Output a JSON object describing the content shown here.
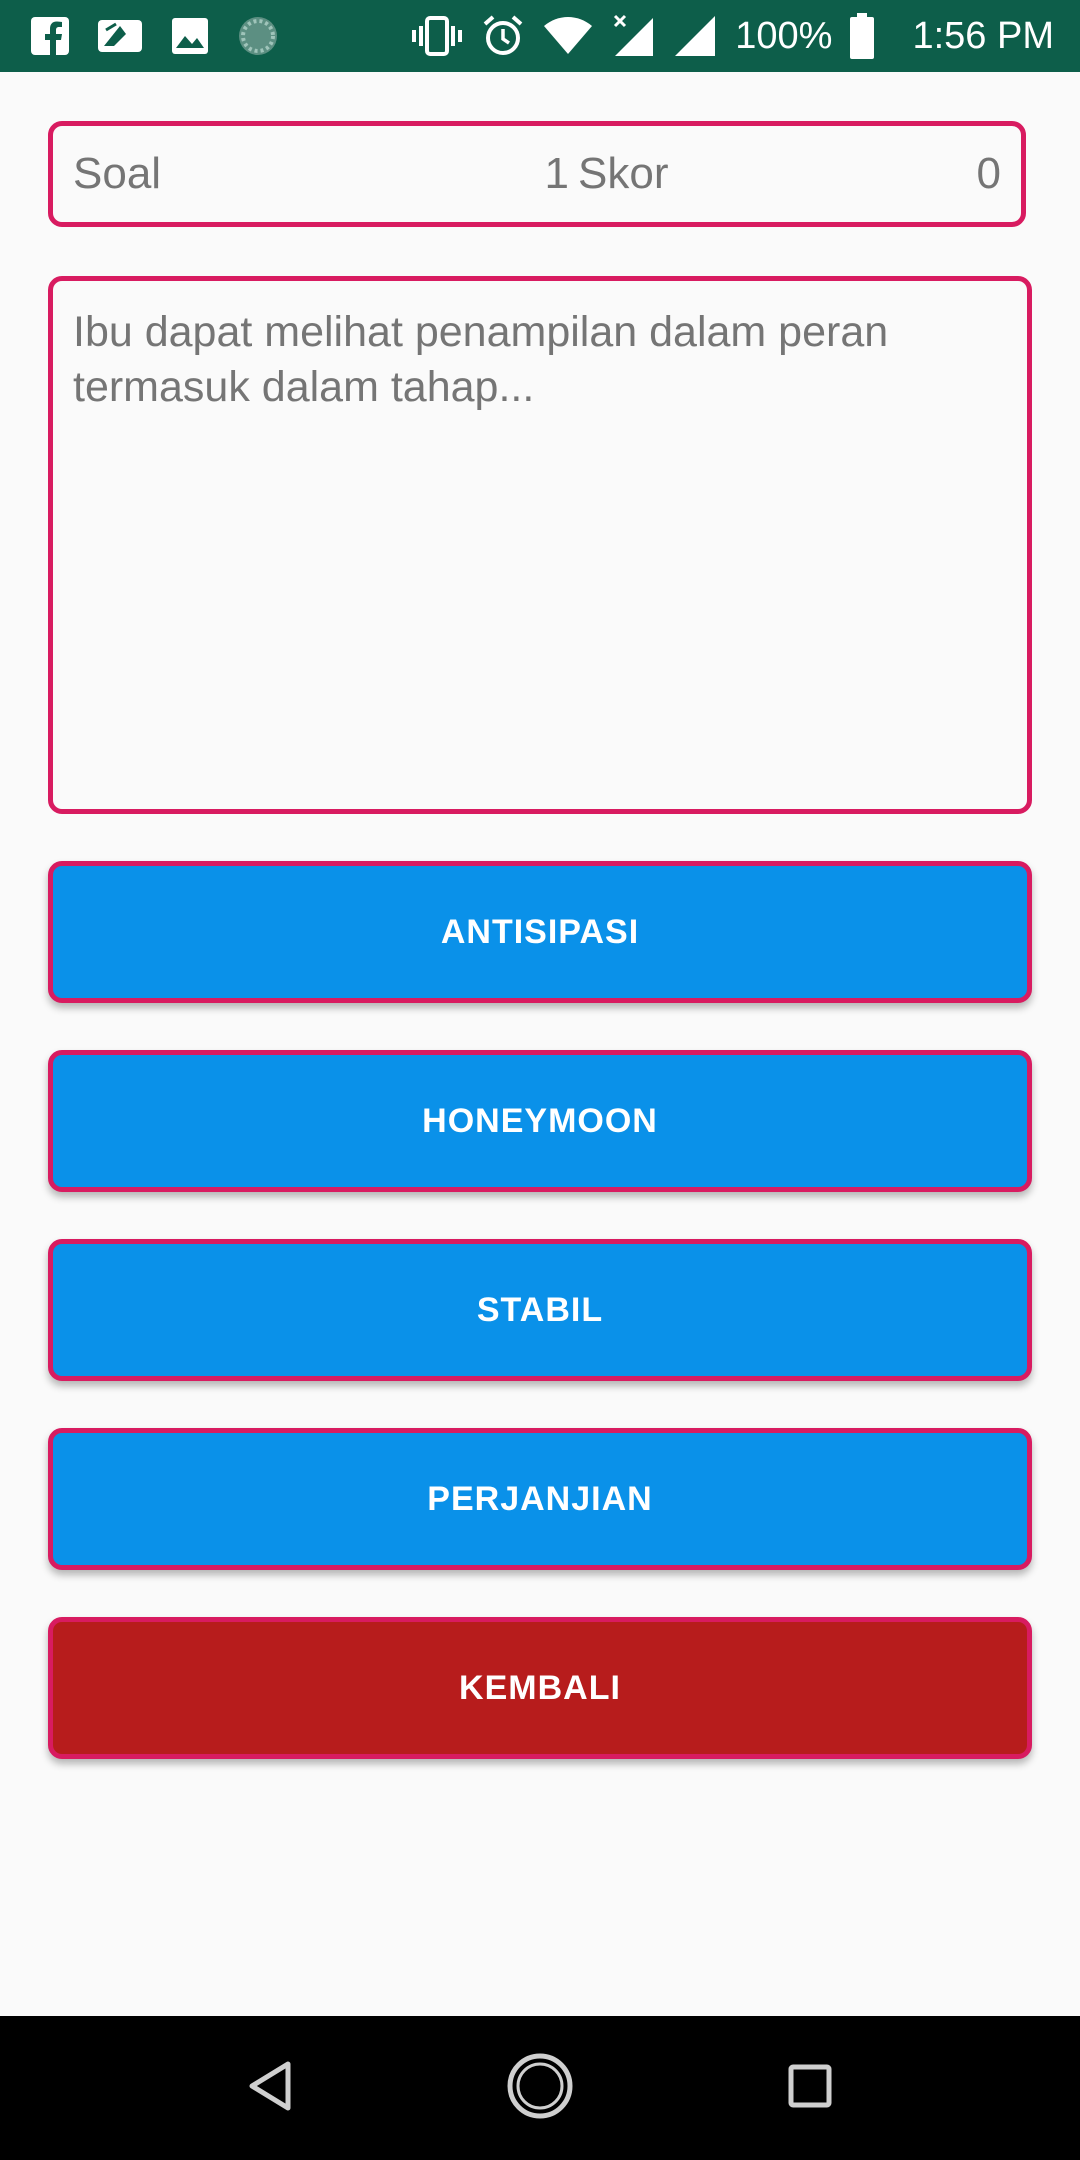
{
  "status_bar": {
    "battery": "100%",
    "time": "1:56 PM",
    "left_icons": [
      "facebook-icon",
      "image-edit-icon",
      "gallery-icon",
      "loading-icon"
    ],
    "right_icons": [
      "vibrate-icon",
      "alarm-icon",
      "wifi-icon",
      "signal-no-data-icon",
      "signal-icon",
      "battery-icon"
    ]
  },
  "score": {
    "soal_label": "Soal",
    "soal_value": "1",
    "skor_label": "Skor",
    "skor_value": "0"
  },
  "question": {
    "text": "Ibu dapat melihat penampilan dalam peran termasuk dalam tahap..."
  },
  "answers": [
    {
      "label": "ANTISIPASI"
    },
    {
      "label": "HONEYMOON"
    },
    {
      "label": "STABIL"
    },
    {
      "label": "PERJANJIAN"
    }
  ],
  "back_button": {
    "label": "KEMBALI"
  },
  "nav_bar": {
    "icons": [
      "nav-back-icon",
      "nav-home-icon",
      "nav-recent-icon"
    ]
  },
  "colors": {
    "status_bar": "#0d5e4a",
    "border": "#d81b60",
    "answer_button": "#0a91e9",
    "back_button": "#b71c1c",
    "text_muted": "#757575",
    "background": "#fafafa"
  }
}
